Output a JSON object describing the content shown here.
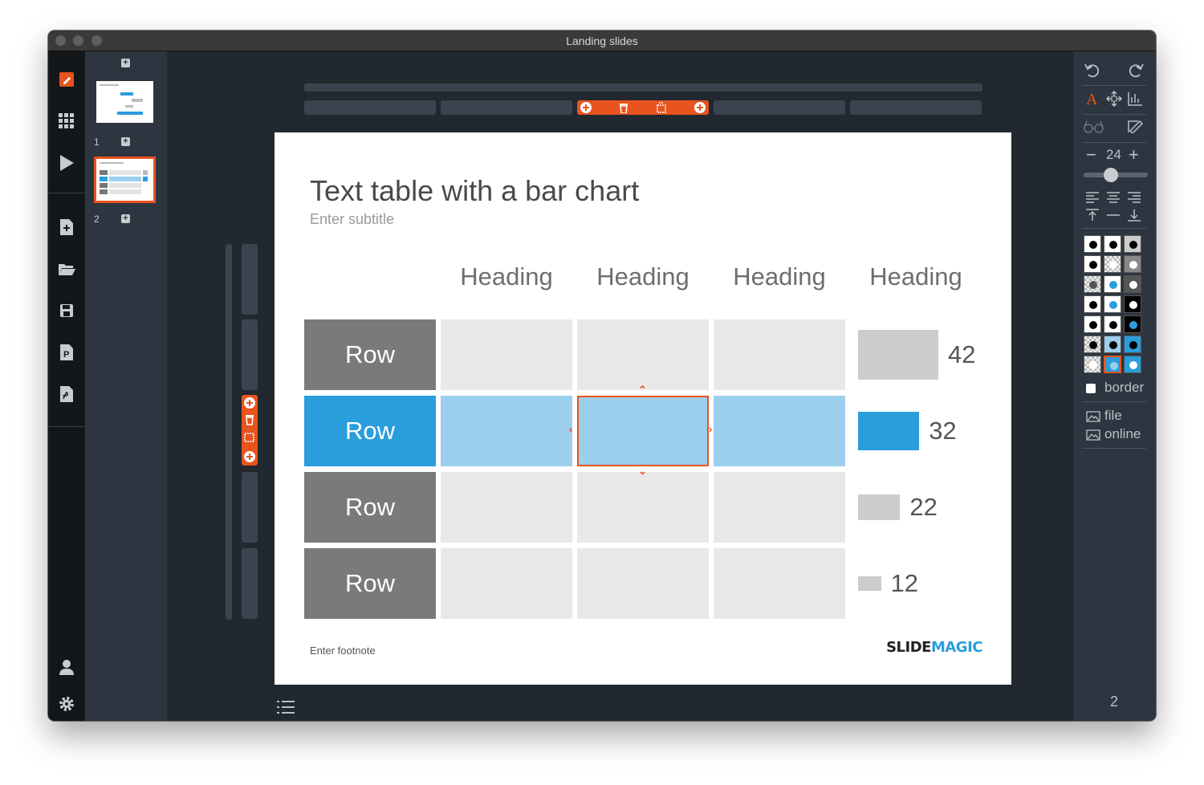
{
  "window": {
    "title": "Landing slides"
  },
  "thumbnails": [
    {
      "number": "1"
    },
    {
      "number": "2"
    }
  ],
  "slide": {
    "title": "Text table with a bar chart",
    "subtitle": "Enter subtitle",
    "footnote": "Enter footnote",
    "logo": {
      "part1": "SLIDE",
      "part2": "MAGIC"
    },
    "headings": [
      "Heading",
      "Heading",
      "Heading",
      "Heading"
    ],
    "rows": [
      {
        "label": "Row",
        "value": "42"
      },
      {
        "label": "Row",
        "value": "32"
      },
      {
        "label": "Row",
        "value": "22"
      },
      {
        "label": "Row",
        "value": "12"
      }
    ]
  },
  "chart_data": {
    "type": "bar",
    "categories": [
      "Row",
      "Row",
      "Row",
      "Row"
    ],
    "values": [
      42,
      32,
      22,
      12
    ],
    "title": "",
    "xlabel": "",
    "ylabel": "",
    "highlight_index": 1
  },
  "right_panel": {
    "font_size": "24",
    "border_label": "border",
    "file_label": "file",
    "online_label": "online"
  },
  "footer": {
    "slide_number": "2"
  },
  "colors": {
    "accent": "#e8541e",
    "highlight": "#2a9ddd",
    "highlight_light": "#9ccfee",
    "row_label_bg": "#7a7a7a",
    "cell_bg": "#e8e8e8",
    "bar_grey": "#cccccc"
  }
}
